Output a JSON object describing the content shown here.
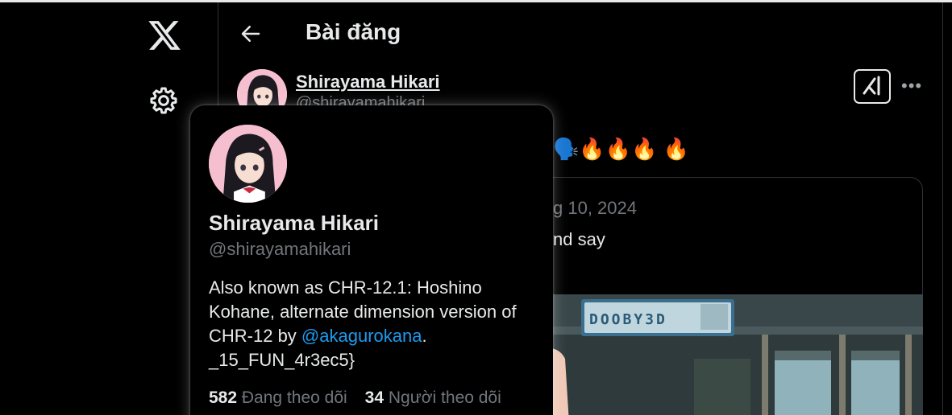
{
  "header": {
    "title": "Bài đăng"
  },
  "post": {
    "author_name": "Shirayama Hikari",
    "author_handle": "@shirayamahikari",
    "text": "🗣️🔥🔥🔥 🔥"
  },
  "quote": {
    "date": "g 10, 2024",
    "text": "nd say",
    "image_sign": "DOOBY3D"
  },
  "hovercard": {
    "name": "Shirayama Hikari",
    "handle": "@shirayamahikari",
    "bio_part1": "Also known as CHR-12.1: Hoshino Kohane, alternate dimension version of CHR-12 by ",
    "bio_link": "@akagurokana",
    "bio_part2": ". _15_FUN_4r3ec5}",
    "following_count": "582",
    "following_label": "Đang theo dõi",
    "followers_count": "34",
    "followers_label": "Người theo dõi"
  },
  "icons": {
    "logo": "x-logo-icon",
    "settings": "gear-icon",
    "back": "arrow-left-icon",
    "grok": "grok-icon",
    "more": "more-horizontal-icon"
  },
  "colors": {
    "background": "#000000",
    "text": "#e7e9ea",
    "muted": "#71767b",
    "link": "#1d9bf0",
    "border": "#2f3336"
  }
}
